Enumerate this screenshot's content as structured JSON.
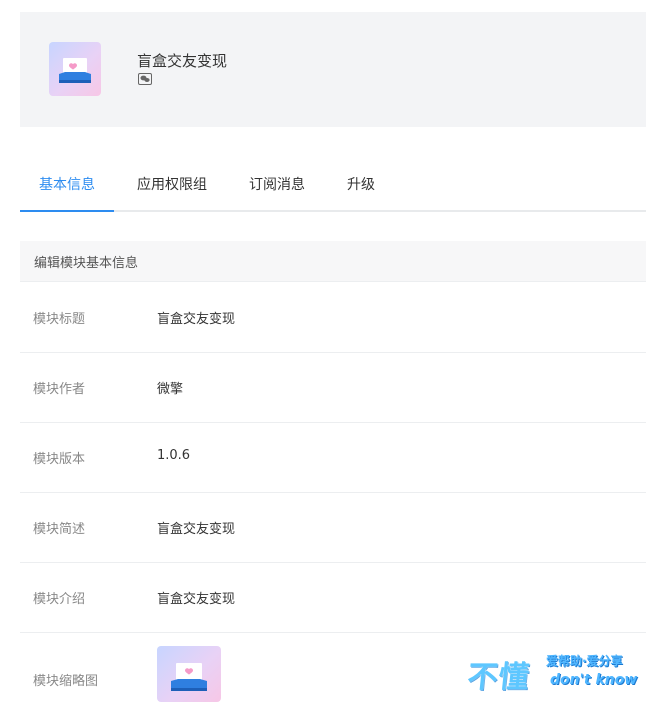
{
  "app": {
    "title": "盲盒交友变现",
    "icon": "blind-box-icon",
    "sub_icon": "wechat-icon"
  },
  "tabs": [
    {
      "label": "基本信息",
      "active": true
    },
    {
      "label": "应用权限组",
      "active": false
    },
    {
      "label": "订阅消息",
      "active": false
    },
    {
      "label": "升级",
      "active": false
    }
  ],
  "section": {
    "title": "编辑模块基本信息"
  },
  "fields": [
    {
      "label": "模块标题",
      "value": "盲盒交友变现"
    },
    {
      "label": "模块作者",
      "value": "微擎"
    },
    {
      "label": "模块版本",
      "value": "1.0.6"
    },
    {
      "label": "模块简述",
      "value": "盲盒交友变现"
    },
    {
      "label": "模块介绍",
      "value": "盲盒交友变现"
    },
    {
      "label": "模块缩略图",
      "value": ""
    }
  ],
  "watermark": {
    "main": "不懂",
    "top": "爱帮助·爱分享",
    "bottom": "don't know"
  },
  "colors": {
    "accent": "#2d8cf0",
    "header_bg": "#f3f4f6"
  }
}
